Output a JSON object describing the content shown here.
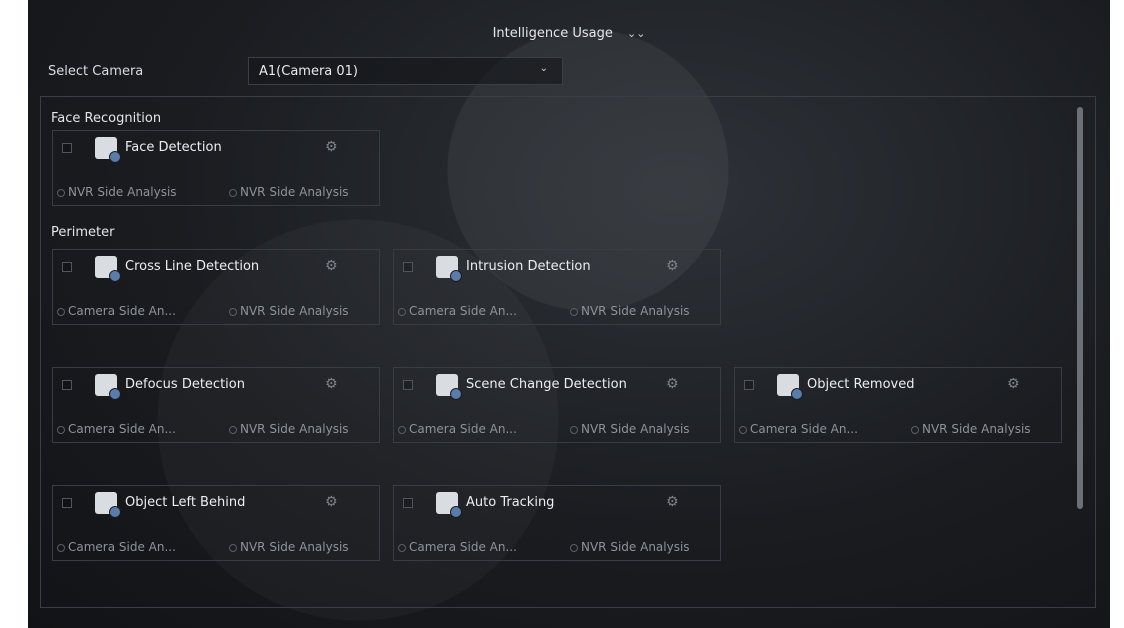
{
  "header": {
    "title": "Intelligence Usage",
    "toggle_icon": "double-chevron-down-icon"
  },
  "camera": {
    "label": "Select Camera",
    "selected": "A1(Camera 01)",
    "dropdown_icon": "chevron-down-icon"
  },
  "sections": [
    {
      "title": "Face Recognition",
      "cards": [
        {
          "name": "Face Detection",
          "icon": "face-detection-icon",
          "options": [
            "NVR Side Analysis",
            "NVR Side Analysis"
          ]
        }
      ]
    },
    {
      "title": "Perimeter",
      "cards": [
        {
          "name": "Cross Line Detection",
          "icon": "cross-line-detection-icon",
          "options": [
            "Camera Side An...",
            "NVR Side Analysis"
          ]
        },
        {
          "name": "Intrusion Detection",
          "icon": "intrusion-detection-icon",
          "options": [
            "Camera Side An...",
            "NVR Side Analysis"
          ]
        },
        {
          "name": "Defocus Detection",
          "icon": "defocus-detection-icon",
          "options": [
            "Camera Side An...",
            "NVR Side Analysis"
          ]
        },
        {
          "name": "Scene Change Detection",
          "icon": "scene-change-detection-icon",
          "options": [
            "Camera Side An...",
            "NVR Side Analysis"
          ]
        },
        {
          "name": "Object Removed",
          "icon": "object-removed-icon",
          "options": [
            "Camera Side An...",
            "NVR Side Analysis"
          ]
        },
        {
          "name": "Object Left Behind",
          "icon": "object-left-behind-icon",
          "options": [
            "Camera Side An...",
            "NVR Side Analysis"
          ]
        },
        {
          "name": "Auto Tracking",
          "icon": "auto-tracking-icon",
          "options": [
            "Camera Side An...",
            "NVR Side Analysis"
          ]
        }
      ]
    }
  ],
  "settings_icon": "gear-icon"
}
